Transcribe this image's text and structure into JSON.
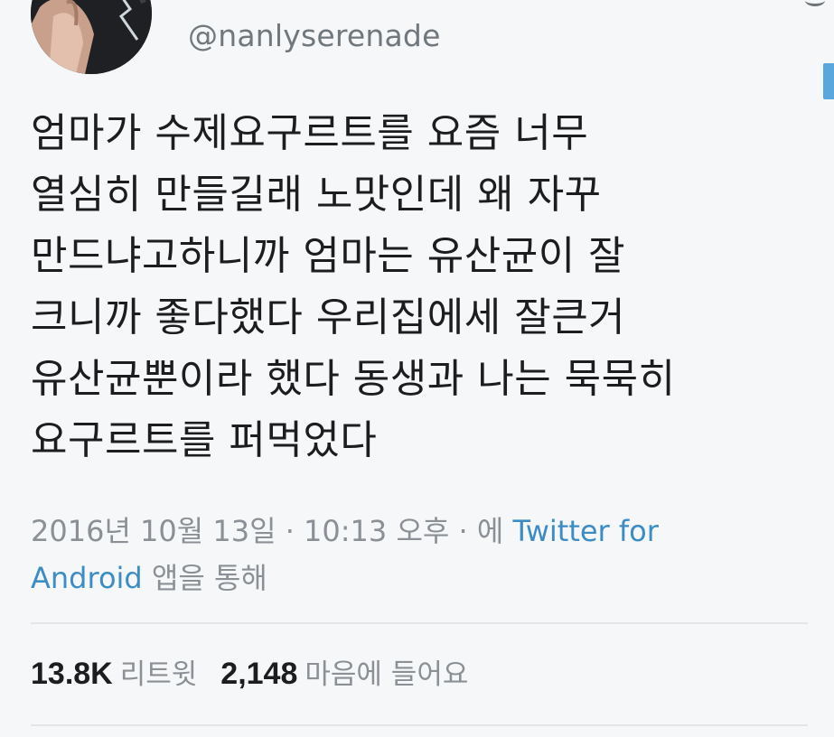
{
  "user": {
    "handle": "@nanlyserenade"
  },
  "tweet": {
    "lines": [
      "엄마가 수제요구르트를 요즘 너무",
      "열심히 만들길래 노맛인데 왜 자꾸",
      "만드냐고하니까 엄마는 유산균이 잘",
      "크니까 좋다했다 우리집에세 잘큰거",
      "유산균뿐이라 했다 동생과 나는 묵묵히",
      "요구르트를 퍼먹었다"
    ]
  },
  "meta": {
    "datetime": "2016년 10월 13일 · 10:13 오후 · 에 ",
    "source_part1": "Twitter for",
    "source_part2": "Android",
    "via_suffix": " 앱을 통해"
  },
  "stats": {
    "retweets_count": "13.8K",
    "retweets_label": "리트윗",
    "likes_count": "2,148",
    "likes_label": "마음에 들어요"
  },
  "colors": {
    "background": "#f5f7f8",
    "text": "#1b1d1f",
    "secondary": "#8a9096",
    "link": "#3c8dc6",
    "accent": "#5aa7dd"
  },
  "icons": [
    "avatar"
  ]
}
